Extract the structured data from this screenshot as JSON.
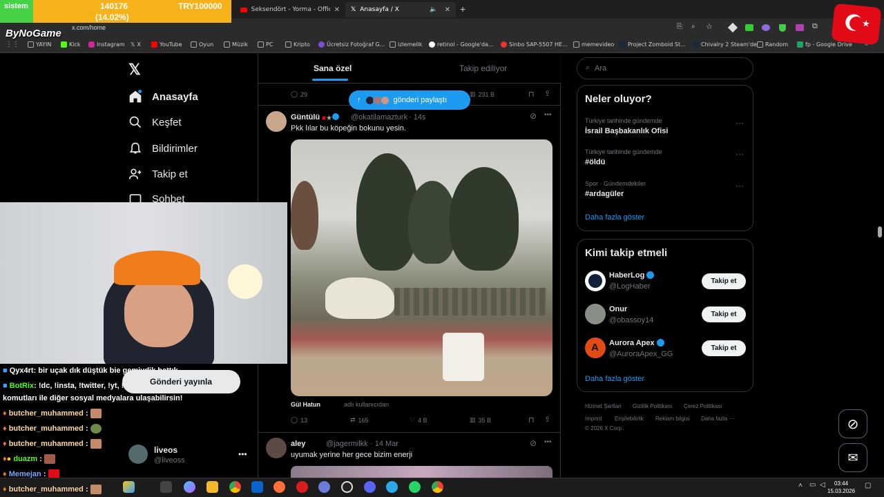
{
  "overlay": {
    "label": "sistem",
    "current": "140176",
    "percent": "(14.02%)",
    "goal": "TRY100000",
    "brand": "ByNoGame"
  },
  "browser": {
    "tabs": [
      {
        "title": "Seksendört - Yorma - Official V",
        "icon": "youtube-icon"
      },
      {
        "title": "Anasayfa / X",
        "icon": "x-icon"
      }
    ],
    "url": "x.com/home",
    "bookmarks": [
      "YAYIN",
      "Kick",
      "Instagram",
      "X",
      "YouTube",
      "Oyun",
      "Müzik",
      "PC",
      "Kripto",
      "Ücretsiz Fotoğraf G...",
      "izlemelik",
      "retinol - Google'da...",
      "Sinbo SAP-5507 HE...",
      "memevideo",
      "Project Zomboid St...",
      "Chivalry 2 Steam'de",
      "Random",
      "fp - Google Drive"
    ]
  },
  "nav": {
    "items": [
      {
        "label": "Anasayfa",
        "icon": "home-icon"
      },
      {
        "label": "Keşfet",
        "icon": "search-icon"
      },
      {
        "label": "Bildirimler",
        "icon": "bell-icon"
      },
      {
        "label": "Takip et",
        "icon": "add-user-icon"
      },
      {
        "label": "Sohbet",
        "icon": "mail-icon"
      }
    ],
    "profile": {
      "name": "liveos",
      "handle": "@liveoss"
    }
  },
  "feed": {
    "tabs": [
      "Sana özel",
      "Takip ediliyor"
    ],
    "prev_stats": {
      "replies": "29",
      "views": "231 B"
    },
    "new_posts_pill": "gönderi paylaştı",
    "post1": {
      "name": "Güntülü",
      "handle": "@okatilamazturk",
      "time": "· 14s",
      "text": "Pkk lılar bu köpeğin bokunu yesin.",
      "source_name": "Gül Hatun",
      "source_note": "adlı kullanıcıdan",
      "replies": "13",
      "reposts": "165",
      "likes": "4 B",
      "views": "35 B"
    },
    "post2": {
      "name": "aley",
      "handle": "@jagermilkk",
      "time": "· 14 Mar",
      "text": "uyumak yerine her gece bizim enerji"
    }
  },
  "right": {
    "search_placeholder": "Ara",
    "trends_title": "Neler oluyor?",
    "trends": [
      {
        "meta": "Türkiye tarihinde gündemde",
        "name": "İsrail Başbakanlık Ofisi"
      },
      {
        "meta": "Türkiye tarihinde gündemde",
        "name": "#öldü"
      },
      {
        "meta": "Spor · Gündemdekiler",
        "name": "#ardagüler"
      }
    ],
    "show_more": "Daha fazla göster",
    "who_title": "Kimi takip etmeli",
    "who": [
      {
        "name": "HaberLog",
        "handle": "@LogHaber",
        "button": "Takip et"
      },
      {
        "name": "Onur",
        "handle": "@obassoy14",
        "button": "Takip et"
      },
      {
        "name": "Aurora Apex",
        "handle": "@AuroraApex_GG",
        "button": "Takip et"
      }
    ],
    "footer": [
      "Hizmet Şartları",
      "Gizlilik Politikası",
      "Çerez Politikası",
      "Imprint",
      "Erişilebilirlik",
      "Reklam bilgisi",
      "Daha fazla ···",
      "© 2026 X Corp."
    ]
  },
  "chat": [
    {
      "user": "Qyx4rt",
      "msg": ": bir uçak dık düştük bie gemiydik battık"
    },
    {
      "user": "BotRix",
      "msg": ": !dc, !insta, !twitter, !yt, !tiktok"
    },
    {
      "user": "",
      "msg": "komutları ile diğer sosyal medyalara ulaşabilirsin!"
    },
    {
      "user": "butcher_muhammed",
      "msg": " :"
    },
    {
      "user": "butcher_muhammed",
      "msg": " :"
    },
    {
      "user": "butcher_muhammed",
      "msg": " :"
    },
    {
      "user": "duazm",
      "msg": " :"
    },
    {
      "user": "Memejan",
      "msg": " :"
    },
    {
      "user": "butcher_muhammed",
      "msg": " :"
    }
  ],
  "toast": "Gönderi yayınla",
  "clock": {
    "time": "03:44",
    "date": "15.03.2026"
  }
}
